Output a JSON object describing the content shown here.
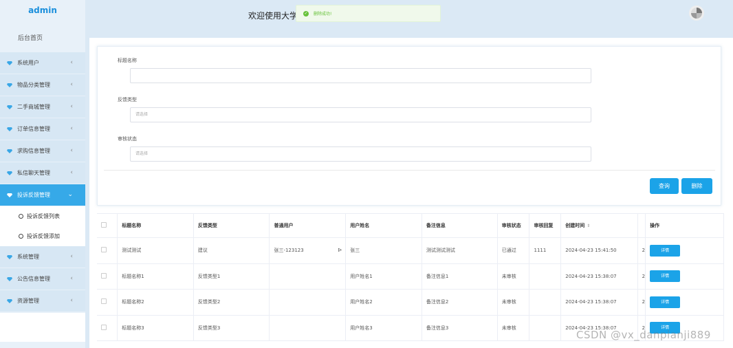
{
  "brand": "admin",
  "header": {
    "welcome": "欢迎使用大学",
    "toast": "删除成功!"
  },
  "sidebar": {
    "home": "后台首页",
    "items_top": [
      {
        "label": "系统用户"
      },
      {
        "label": "物品分类管理"
      },
      {
        "label": "二手商城管理"
      },
      {
        "label": "订单信息管理"
      },
      {
        "label": "求购信息管理"
      },
      {
        "label": "私信聊天管理"
      }
    ],
    "active": {
      "label": "投诉反馈管理"
    },
    "sub_items": [
      {
        "label": "投诉反馈列表"
      },
      {
        "label": "投诉反馈添加"
      }
    ],
    "items_bottom": [
      {
        "label": "系统管理"
      },
      {
        "label": "公告信息管理"
      },
      {
        "label": "资源管理"
      }
    ]
  },
  "search": {
    "title_label": "标题名称",
    "title_value": "",
    "type_label": "反馈类型",
    "type_placeholder": "请选择",
    "status_label": "审核状态",
    "status_placeholder": "请选择",
    "query_button": "查询",
    "delete_button": "删除"
  },
  "table": {
    "headers": [
      "标题名称",
      "反馈类型",
      "普通用户",
      "用户姓名",
      "备注信息",
      "审核状态",
      "审核回复",
      "创建时间",
      "",
      "操作"
    ],
    "rows": [
      [
        "测试测试",
        "建议",
        "张三-123123",
        "张三",
        "测试测试测试",
        "已通过",
        "1111",
        "2024-04-23 15:41:50",
        "2",
        "详情"
      ],
      [
        "标题名称1",
        "反馈类型1",
        "",
        "用户姓名1",
        "备注信息1",
        "未审核",
        "",
        "2024-04-23 15:38:07",
        "2",
        "详情"
      ],
      [
        "标题名称2",
        "反馈类型2",
        "",
        "用户姓名2",
        "备注信息2",
        "未审核",
        "",
        "2024-04-23 15:38:07",
        "2",
        "详情"
      ],
      [
        "标题名称3",
        "反馈类型3",
        "",
        "用户姓名3",
        "备注信息3",
        "未审核",
        "",
        "2024-04-23 15:38:07",
        "2",
        "详情"
      ]
    ]
  },
  "watermark": "CSDN @vx_danpianji889",
  "colors": {
    "accent": "#1ba3e8",
    "active_nav": "#36a9e8",
    "success": "#67c23a"
  }
}
